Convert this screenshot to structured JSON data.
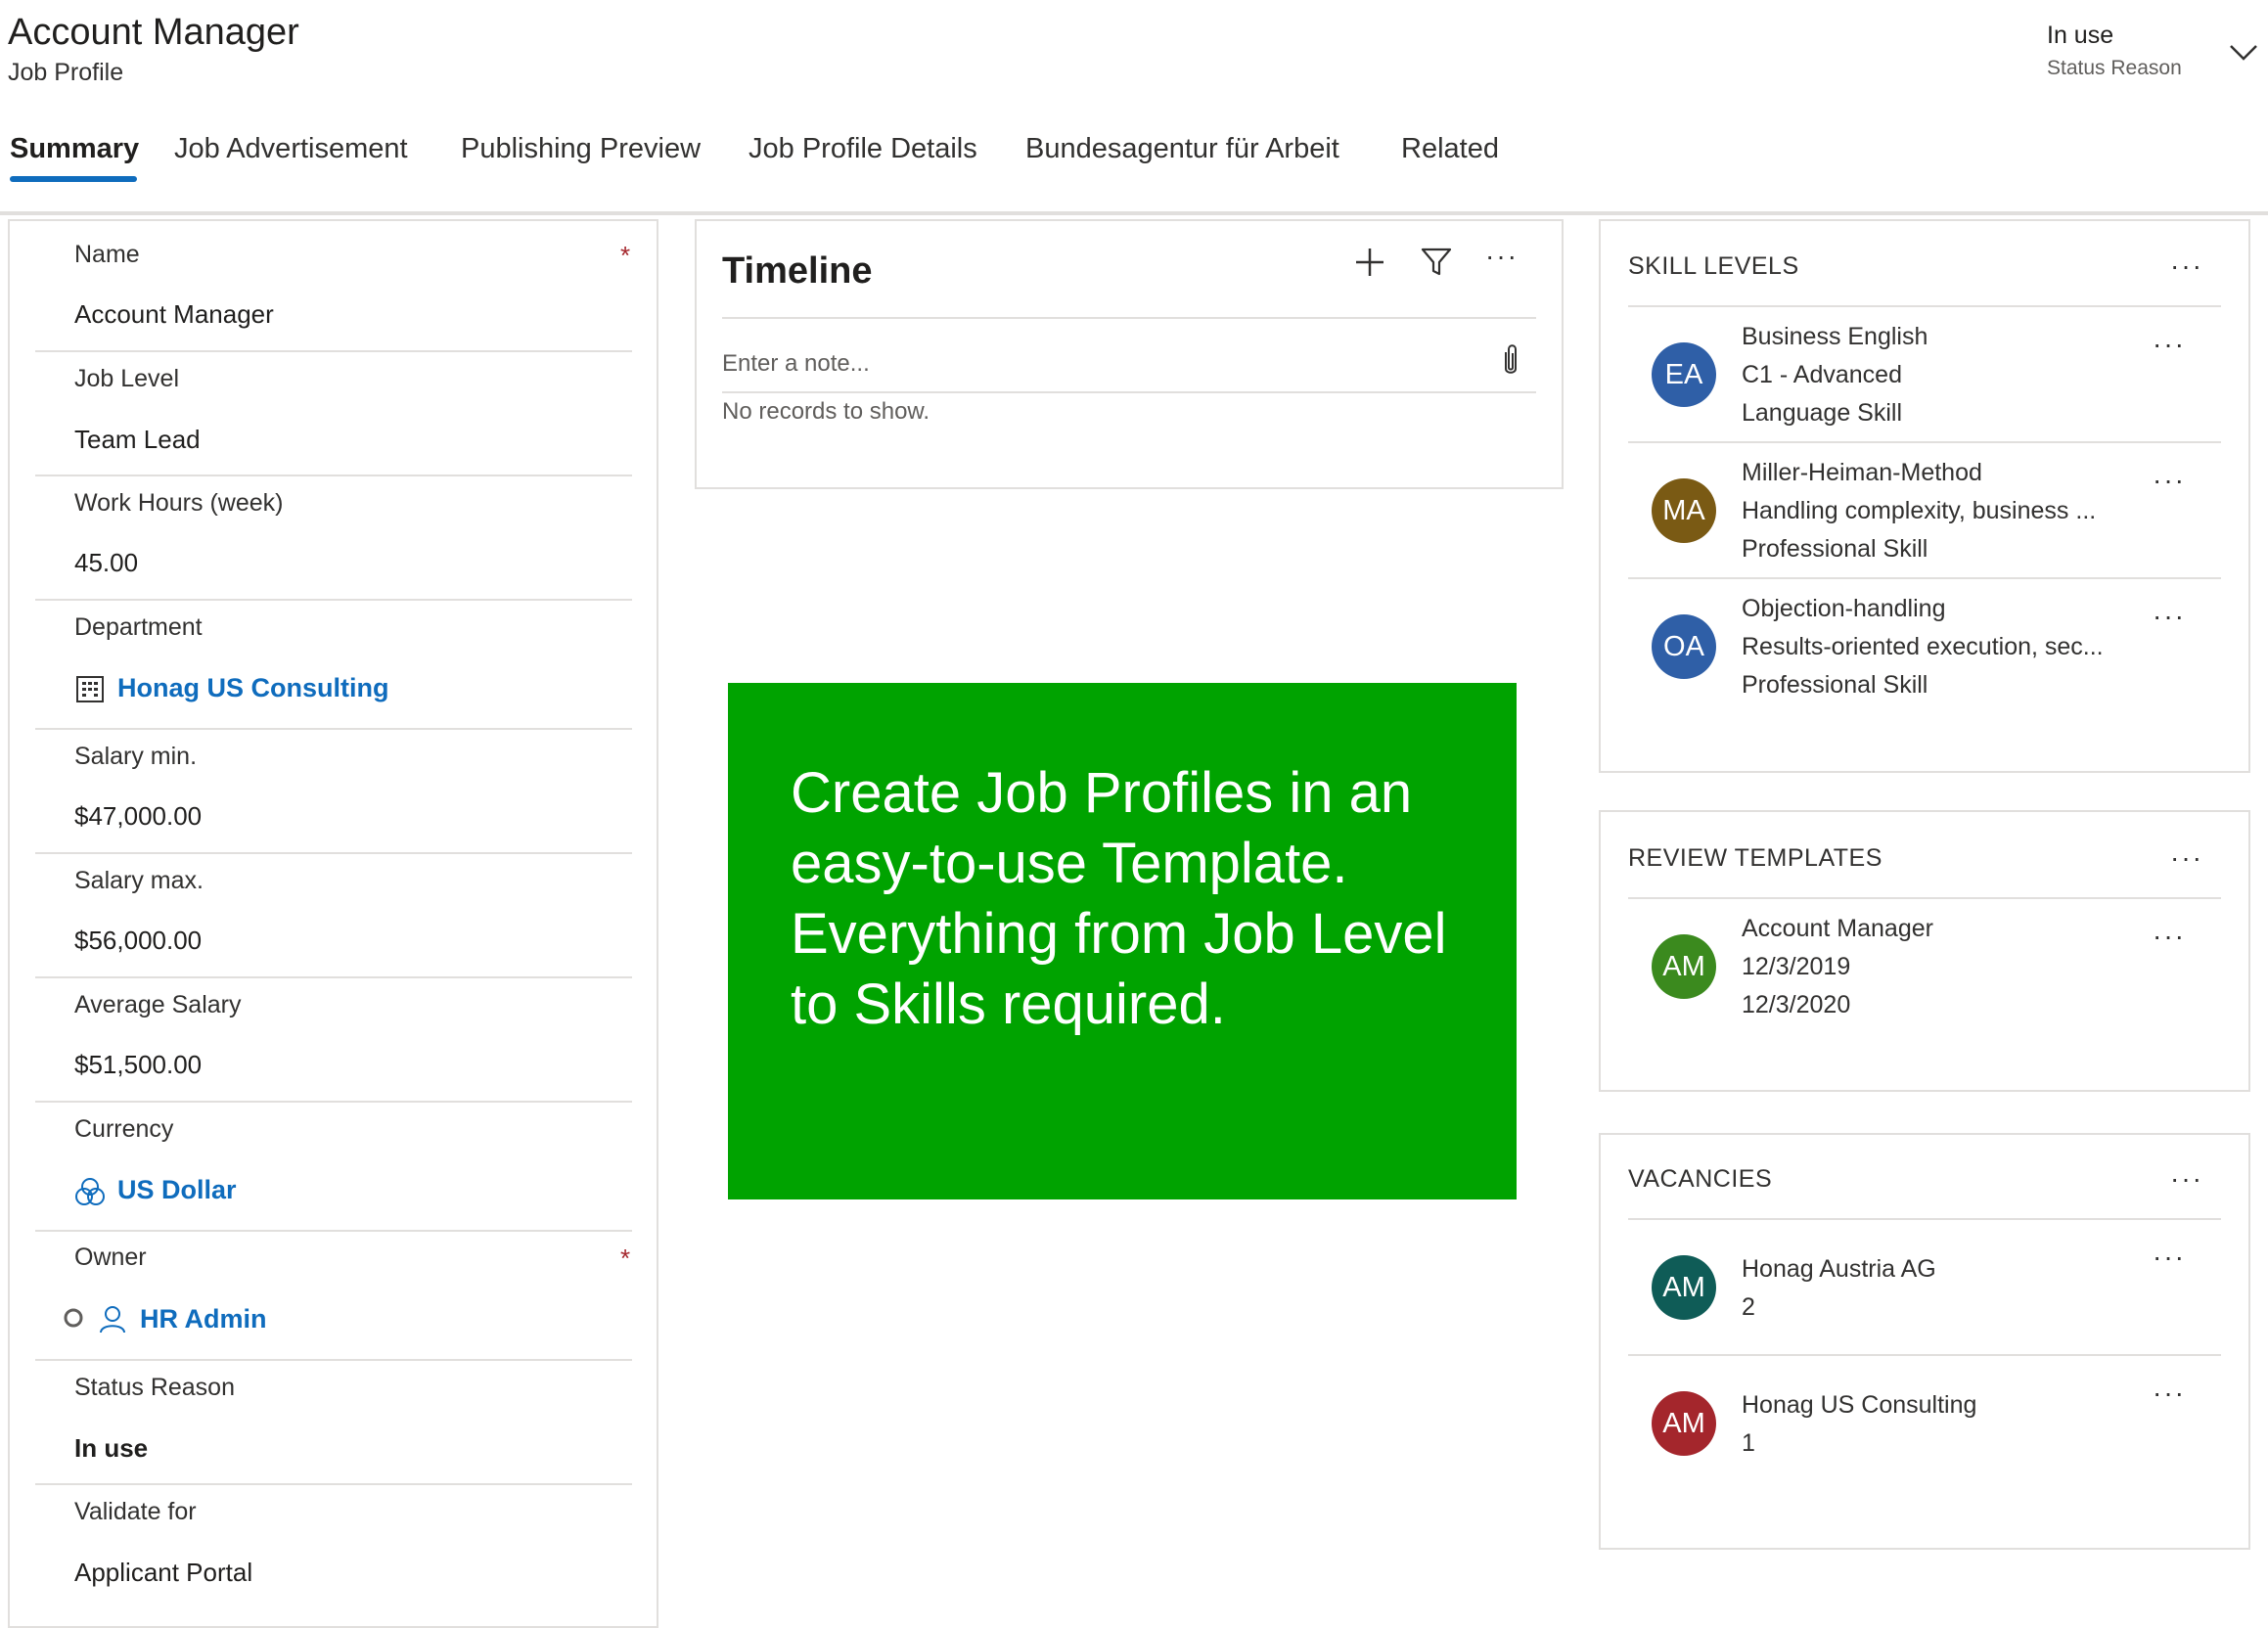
{
  "header": {
    "title": "Account Manager",
    "subtitle": "Job Profile",
    "status_value": "In use",
    "status_label": "Status Reason"
  },
  "tabs": [
    {
      "label": "Summary",
      "active": true
    },
    {
      "label": "Job Advertisement"
    },
    {
      "label": "Publishing Preview"
    },
    {
      "label": "Job Profile Details"
    },
    {
      "label": "Bundesagentur für Arbeit"
    },
    {
      "label": "Related"
    }
  ],
  "form": {
    "fields": [
      {
        "label": "Name",
        "value": "Account Manager",
        "required": true
      },
      {
        "label": "Job Level",
        "value": "Team Lead"
      },
      {
        "label": "Work Hours (week)",
        "value": "45.00"
      },
      {
        "label": "Department",
        "value": "Honag US Consulting",
        "type": "lookup",
        "icon": "building-icon"
      },
      {
        "label": "Salary min.",
        "value": "$47,000.00"
      },
      {
        "label": "Salary max.",
        "value": "$56,000.00"
      },
      {
        "label": "Average Salary",
        "value": "$51,500.00"
      },
      {
        "label": "Currency",
        "value": "US Dollar",
        "type": "lookup",
        "icon": "currency-icon"
      },
      {
        "label": "Owner",
        "value": "HR Admin",
        "type": "lookup",
        "icon": "person-icon",
        "required": true
      },
      {
        "label": "Status Reason",
        "value": "In use",
        "bold": true
      },
      {
        "label": "Validate for",
        "value": "Applicant Portal"
      }
    ],
    "required_mark": "*"
  },
  "timeline": {
    "title": "Timeline",
    "note_placeholder": "Enter a note...",
    "empty_text": "No records to show."
  },
  "promo": {
    "text": "Create Job Profiles in an easy-to-use Template. Everything from Job Level to Skills required.",
    "color": "#00a300"
  },
  "skill_levels": {
    "title": "SKILL LEVELS",
    "items": [
      {
        "initials": "EA",
        "color": "#2f5fa7",
        "lines": [
          "Business English",
          "C1 - Advanced",
          "Language Skill"
        ]
      },
      {
        "initials": "MA",
        "color": "#7a5a14",
        "lines": [
          "Miller-Heiman-Method",
          "Handling complexity, business ...",
          "Professional Skill"
        ]
      },
      {
        "initials": "OA",
        "color": "#2f5fa7",
        "lines": [
          "Objection-handling",
          "Results-oriented execution, sec...",
          "Professional Skill"
        ]
      }
    ]
  },
  "review_templates": {
    "title": "REVIEW TEMPLATES",
    "items": [
      {
        "initials": "AM",
        "color": "#3b8a1e",
        "lines": [
          "Account Manager",
          "12/3/2019",
          "12/3/2020"
        ]
      }
    ]
  },
  "vacancies": {
    "title": "VACANCIES",
    "items": [
      {
        "initials": "AM",
        "color": "#0f5c57",
        "lines": [
          "Honag Austria AG",
          "2"
        ]
      },
      {
        "initials": "AM",
        "color": "#a4262c",
        "lines": [
          "Honag US Consulting",
          "1"
        ]
      }
    ]
  },
  "more_label": "···",
  "colors": {
    "accent": "#0f6cbd",
    "required": "#a4262c"
  }
}
